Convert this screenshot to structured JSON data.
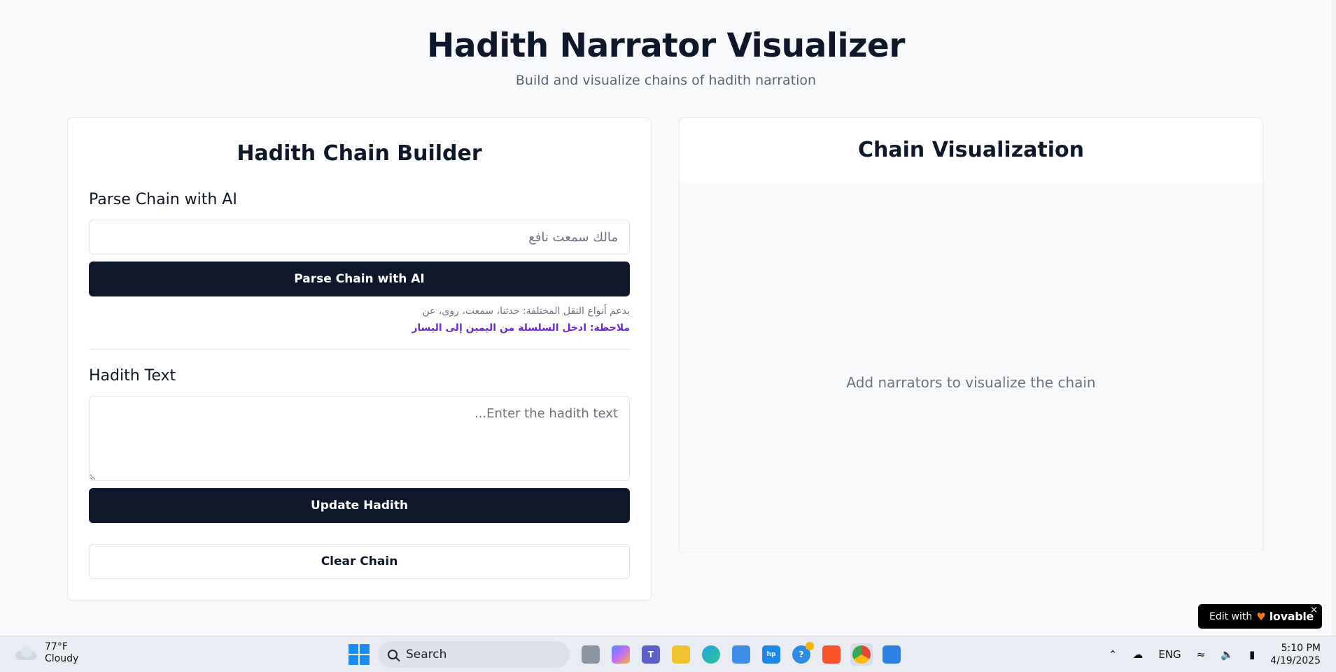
{
  "header": {
    "title": "Hadith Narrator Visualizer",
    "subtitle": "Build and visualize chains of hadith narration"
  },
  "builder": {
    "title": "Hadith Chain Builder",
    "parse_section_label": "Parse Chain with AI",
    "chain_input_placeholder": "مالك سمعت نافع",
    "parse_button": "Parse Chain with AI",
    "hint_types": "يدعم أنواع النقل المختلفة: حدثنا، سمعت، روى، عن",
    "hint_note": "ملاحظة: ادخل السلسلة من اليمين إلى اليسار",
    "hadith_section_label": "Hadith Text",
    "hadith_placeholder": "Enter the hadith text...",
    "update_button": "Update Hadith",
    "clear_button": "Clear Chain"
  },
  "visualization": {
    "title": "Chain Visualization",
    "empty_message": "Add narrators to visualize the chain"
  },
  "badge": {
    "prefix": "Edit with",
    "brand": "lovable",
    "close": "×"
  },
  "taskbar": {
    "weather_temp": "77°F",
    "weather_desc": "Cloudy",
    "search_label": "Search",
    "language": "ENG",
    "time": "5:10 PM",
    "date": "4/19/2025"
  }
}
